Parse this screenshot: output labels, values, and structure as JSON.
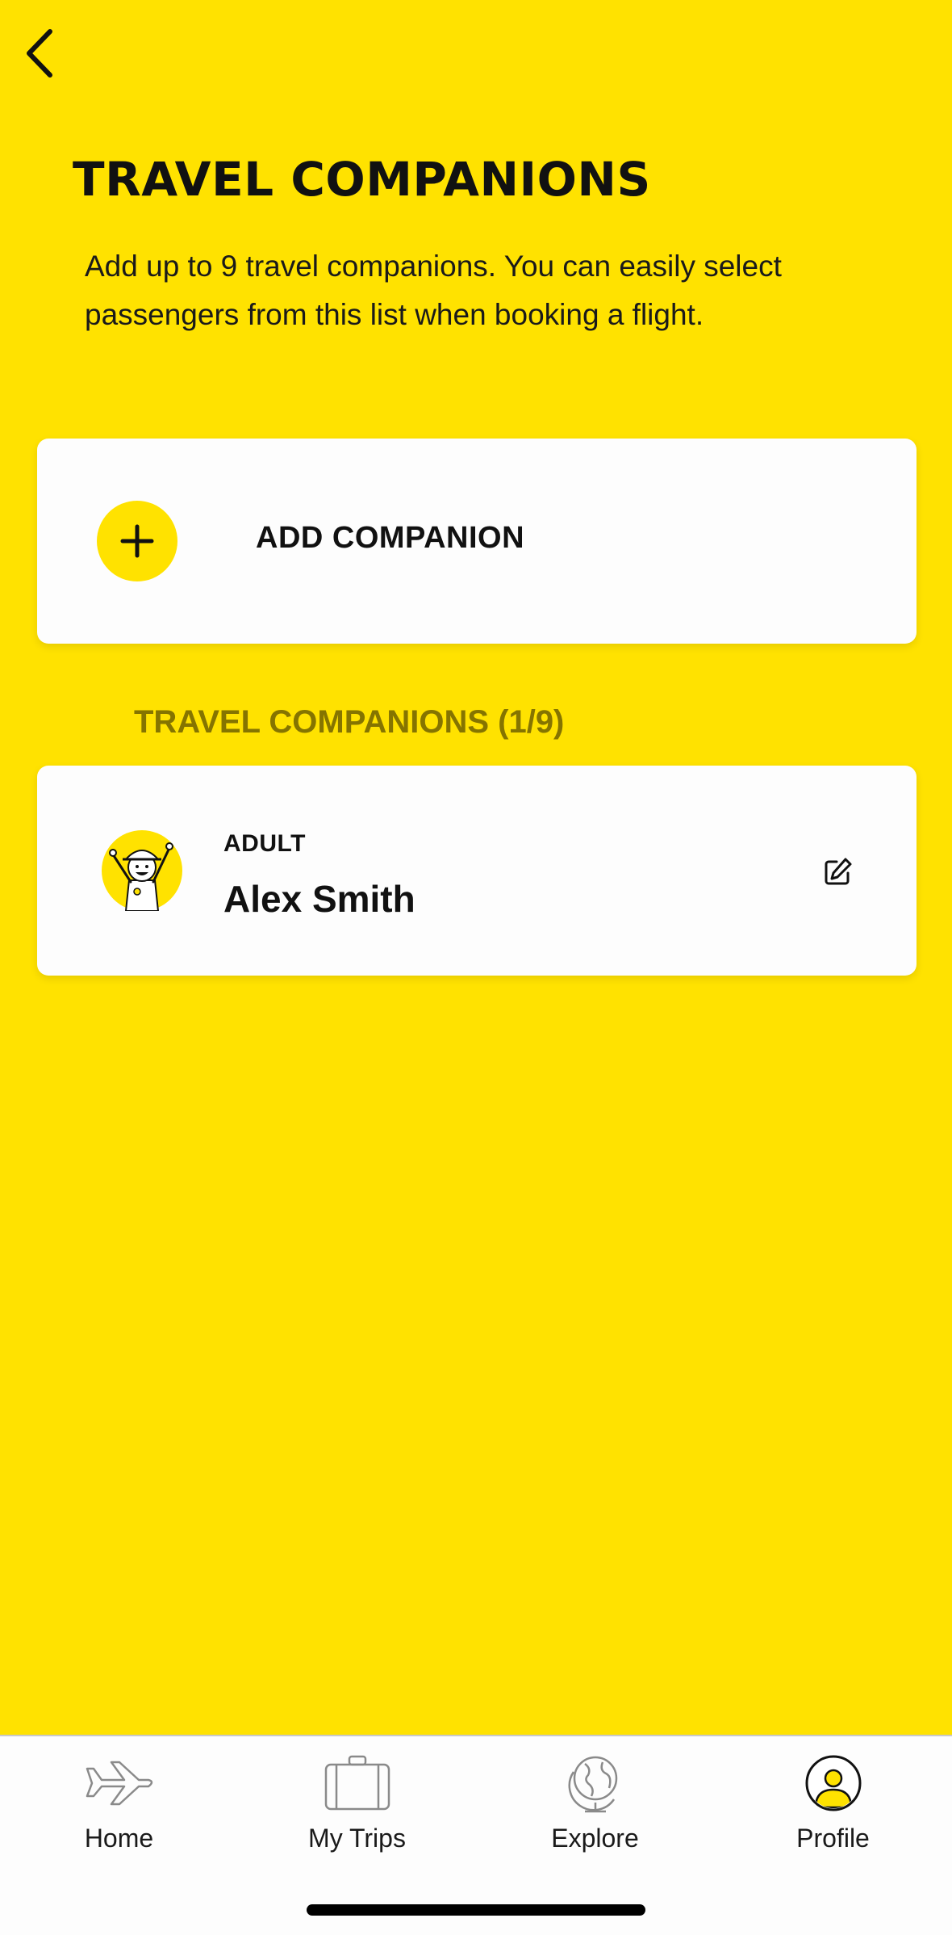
{
  "header": {
    "title": "TRAVEL COMPANIONS",
    "description": "Add up to 9 travel companions. You can easily select passengers from this list when booking a flight."
  },
  "add_companion": {
    "label": "ADD COMPANION"
  },
  "companions_section": {
    "title": "TRAVEL COMPANIONS (1/9)",
    "items": [
      {
        "type": "ADULT",
        "name": "Alex Smith",
        "avatar": "explorer-avatar"
      }
    ]
  },
  "tabbar": {
    "tabs": [
      {
        "label": "Home",
        "icon": "airplane-icon",
        "active": false
      },
      {
        "label": "My Trips",
        "icon": "suitcase-icon",
        "active": false
      },
      {
        "label": "Explore",
        "icon": "globe-icon",
        "active": false
      },
      {
        "label": "Profile",
        "icon": "profile-icon",
        "active": true
      }
    ]
  },
  "colors": {
    "background": "#FFE200",
    "card": "#FDFDFD",
    "section_title": "#857400",
    "text": "#111111"
  }
}
